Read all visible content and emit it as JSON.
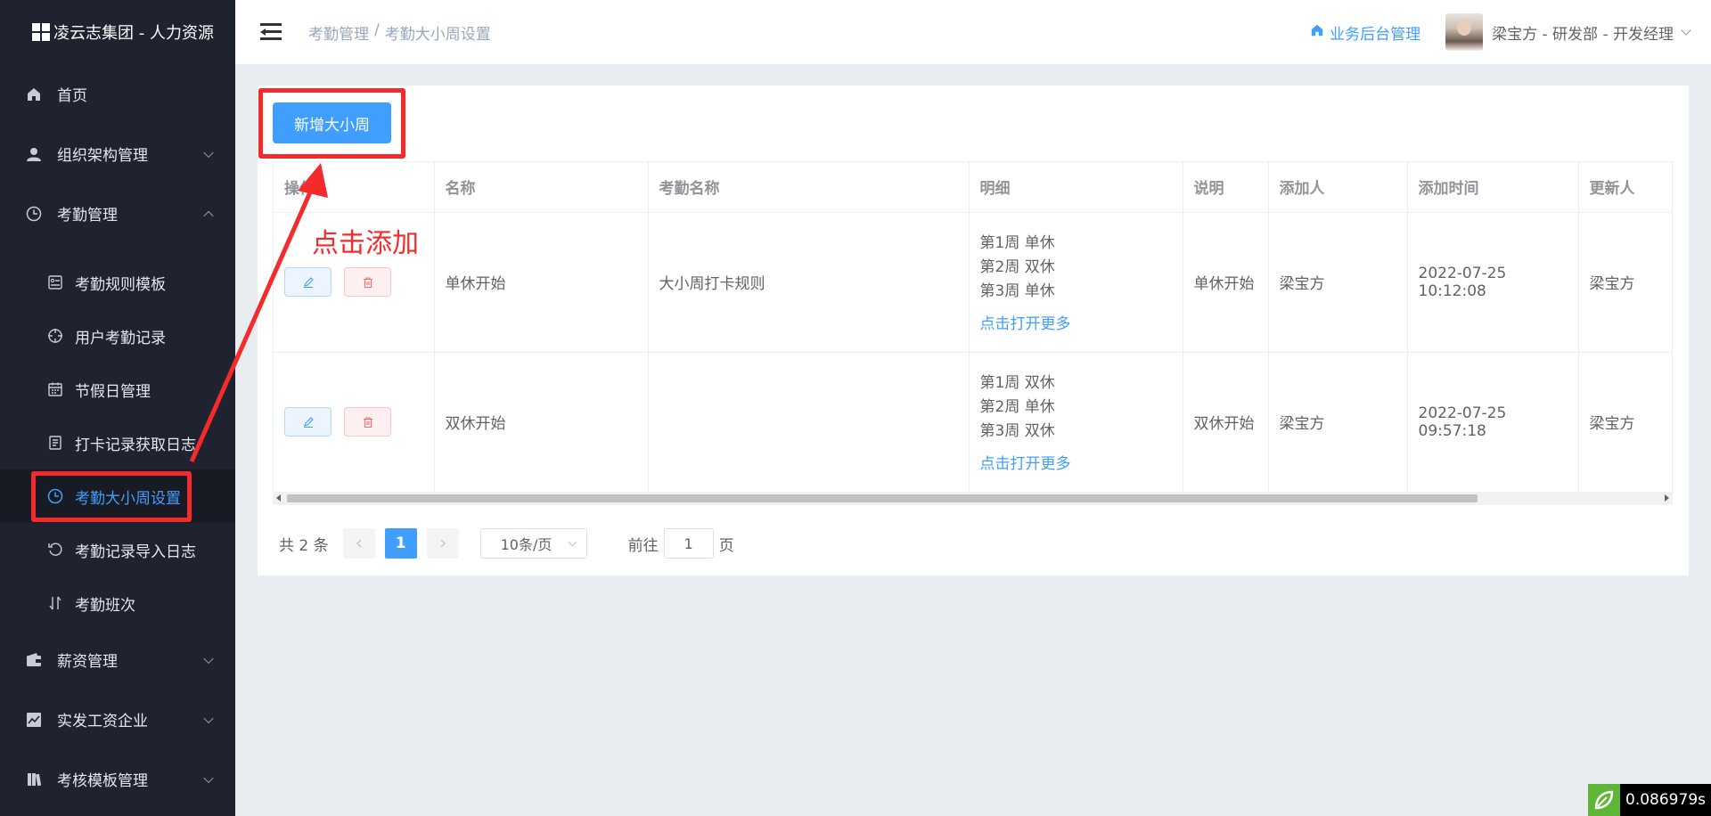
{
  "brand": {
    "title": "凌云志集团 - 人力资源"
  },
  "sidebar": {
    "items": [
      {
        "label": "首页",
        "icon": "home-icon"
      },
      {
        "label": "组织架构管理",
        "icon": "user-icon"
      },
      {
        "label": "考勤管理",
        "icon": "clock-icon"
      }
    ],
    "sub_items": [
      {
        "label": "考勤规则模板",
        "icon": "template-icon"
      },
      {
        "label": "用户考勤记录",
        "icon": "crosshair-icon"
      },
      {
        "label": "节假日管理",
        "icon": "calendar-icon"
      },
      {
        "label": "打卡记录获取日志",
        "icon": "document-icon"
      },
      {
        "label": "考勤大小周设置",
        "icon": "clock-icon"
      },
      {
        "label": "考勤记录导入日志",
        "icon": "refresh-icon"
      },
      {
        "label": "考勤班次",
        "icon": "sort-icon"
      }
    ],
    "bottom_items": [
      {
        "label": "薪资管理",
        "icon": "wallet-icon"
      },
      {
        "label": "实发工资企业",
        "icon": "chart-icon"
      },
      {
        "label": "考核模板管理",
        "icon": "book-icon"
      }
    ]
  },
  "header": {
    "breadcrumb_parent": "考勤管理",
    "breadcrumb_sep": "/",
    "breadcrumb_current": "考勤大小周设置",
    "backend_link": "业务后台管理",
    "user": "梁宝方 - 研发部 - 开发经理"
  },
  "toolbar": {
    "add_label": "新增大小周"
  },
  "table": {
    "columns": [
      "操作",
      "名称",
      "考勤名称",
      "明细",
      "说明",
      "添加人",
      "添加时间",
      "更新人"
    ],
    "rows": [
      {
        "name": "单休开始",
        "rule": "大小周打卡规则",
        "details": [
          "第1周 单休",
          "第2周 双休",
          "第3周 单休"
        ],
        "more": "点击打开更多",
        "note": "单休开始",
        "creator": "梁宝方",
        "time": "2022-07-25 10:12:08",
        "updater": "梁宝方"
      },
      {
        "name": "双休开始",
        "rule": "",
        "details": [
          "第1周 双休",
          "第2周 单休",
          "第3周 双休"
        ],
        "more": "点击打开更多",
        "note": "双休开始",
        "creator": "梁宝方",
        "time": "2022-07-25 09:57:18",
        "updater": "梁宝方"
      }
    ]
  },
  "pagination": {
    "total": "共 2 条",
    "current_page": "1",
    "page_size": "10条/页",
    "goto_label": "前往",
    "goto_value": "1",
    "page_suffix": "页"
  },
  "annotation": {
    "text": "点击添加"
  },
  "timer": {
    "value": "0.086979s"
  },
  "colors": {
    "accent": "#409eff",
    "sidebar_bg": "#1f2330",
    "annotation_red": "#f52a2a"
  }
}
